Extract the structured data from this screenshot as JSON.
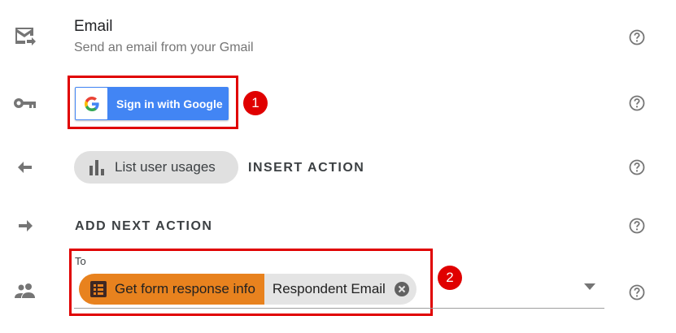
{
  "email_row": {
    "title": "Email",
    "subtitle": "Send an email from your Gmail",
    "icon": "email-send-icon"
  },
  "auth_row": {
    "icon": "key-icon",
    "sign_in_label": "Sign in with Google",
    "badge": "1"
  },
  "insert_row": {
    "icon": "arrow-left-icon",
    "chip_label": "List user usages",
    "chip_icon": "bar-chart-icon",
    "action_label": "INSERT ACTION"
  },
  "next_row": {
    "icon": "arrow-right-icon",
    "action_label": "ADD NEXT ACTION"
  },
  "to_row": {
    "icon": "people-icon",
    "field_label": "To",
    "token_source": "Get form response info",
    "token_source_icon": "form-icon",
    "token_value": "Respondent Email",
    "badge": "2"
  },
  "colors": {
    "annotation_red": "#e00000",
    "google_blue": "#4285f4",
    "token_orange": "#e8821e"
  }
}
